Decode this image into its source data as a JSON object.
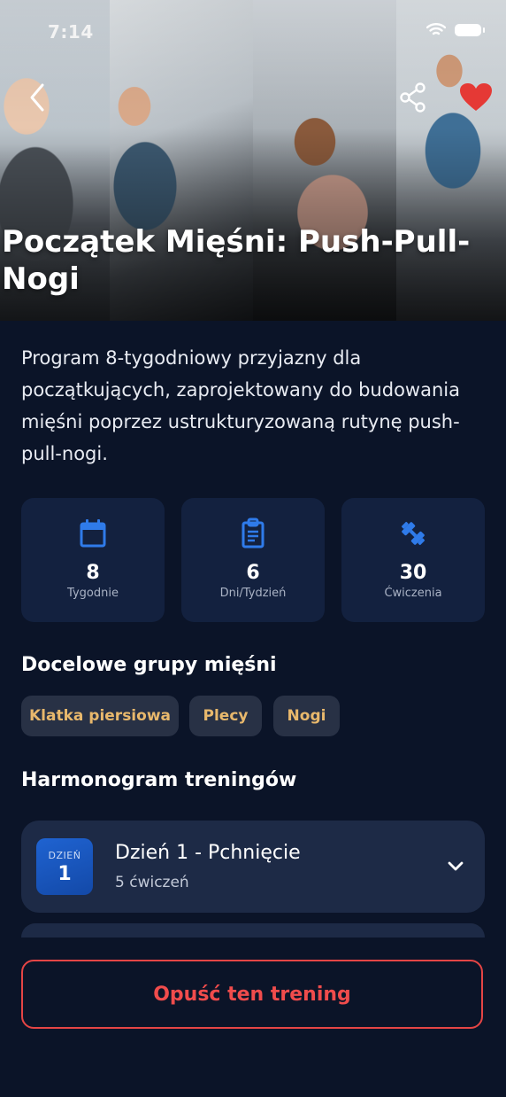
{
  "status_bar": {
    "time": "7:14"
  },
  "hero": {
    "title": "Początek Mięśni: Push-Pull-Nogi",
    "favorite_color": "#e53935"
  },
  "description": "Program 8-tygodniowy przyjazny dla początkujących, zaprojektowany do budowania mięśni poprzez ustrukturyzowaną rutynę push-pull-nogi.",
  "stats": [
    {
      "icon": "calendar-icon",
      "value": "8",
      "label": "Tygodnie"
    },
    {
      "icon": "clipboard-icon",
      "value": "6",
      "label": "Dni/Tydzień"
    },
    {
      "icon": "dumbbell-icon",
      "value": "30",
      "label": "Ćwiczenia"
    }
  ],
  "muscle_groups": {
    "title": "Docelowe grupy mięśni",
    "chips": [
      "Klatka piersiowa",
      "Plecy",
      "Nogi"
    ]
  },
  "schedule": {
    "title": "Harmonogram treningów",
    "days": [
      {
        "badge_label": "DZIEŃ",
        "badge_num": "1",
        "title": "Dzień 1 - Pchnięcie",
        "subtitle": "5 ćwiczeń"
      }
    ]
  },
  "leave_button": "Opuść ten trening",
  "colors": {
    "background": "#0b1428",
    "card": "#13213f",
    "accent_blue": "#1f63d1",
    "chip_text": "#e8b86c",
    "danger": "#e54545"
  }
}
